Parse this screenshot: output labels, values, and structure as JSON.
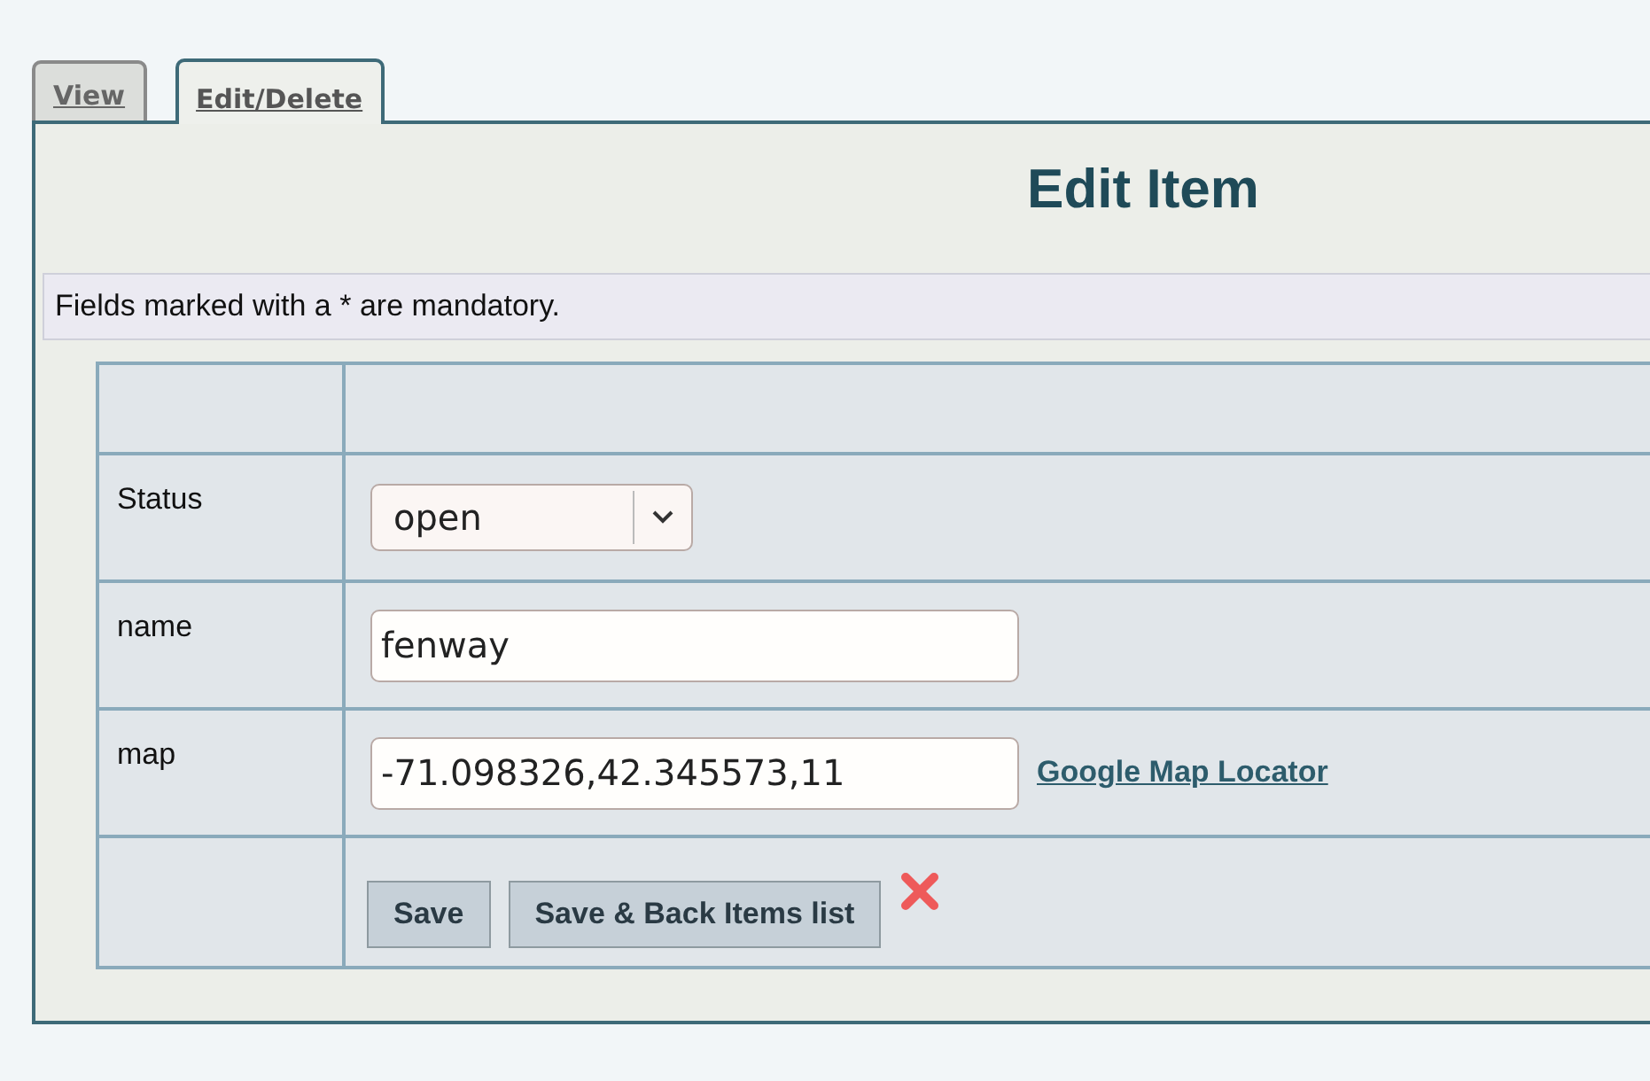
{
  "tabs": [
    {
      "label": "View",
      "selected": false
    },
    {
      "label": "Edit/Delete",
      "selected": true
    }
  ],
  "title": "Edit Item",
  "notice": "Fields marked with a * are mandatory.",
  "fields": [
    {
      "label": "Status",
      "kind": "select",
      "value": "open"
    },
    {
      "label": "name",
      "kind": "text",
      "value": "fenway"
    },
    {
      "label": "map",
      "kind": "text",
      "value": "-71.098326,42.345573,11",
      "link": "Google Map Locator"
    }
  ],
  "buttons": [
    "Save",
    "Save & Back Items list"
  ]
}
